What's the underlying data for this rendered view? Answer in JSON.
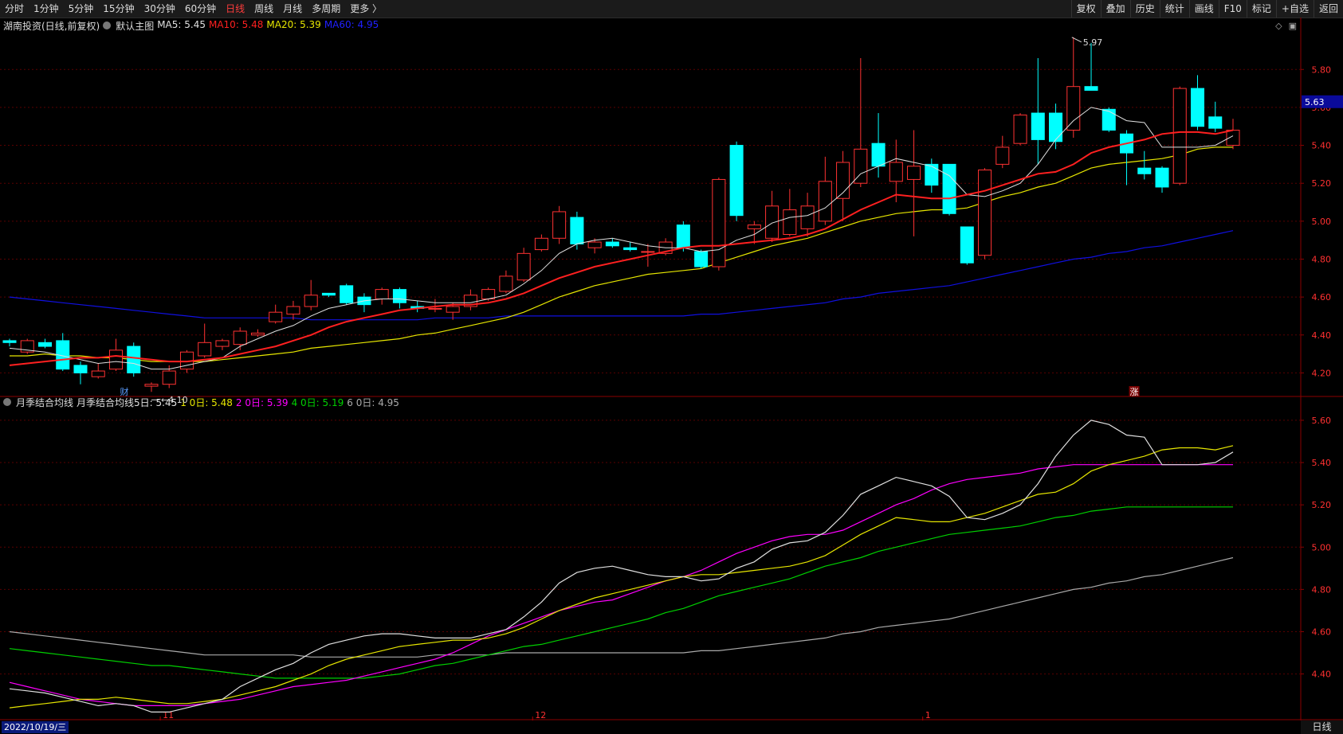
{
  "toolbar": {
    "periods": [
      "分时",
      "1分钟",
      "5分钟",
      "15分钟",
      "30分钟",
      "60分钟",
      "日线",
      "周线",
      "月线",
      "多周期",
      "更多 〉"
    ],
    "active_period": "日线",
    "right_items": [
      "复权",
      "叠加",
      "历史",
      "统计",
      "画线",
      "F10",
      "标记",
      "+自选",
      "返回"
    ]
  },
  "main_info": {
    "stock": "湖南投资(日线,前复权)",
    "template": "默认主图",
    "ma5": "MA5: 5.45",
    "ma10": "MA10: 5.48",
    "ma20": "MA20: 5.39",
    "ma60": "MA60: 4.95"
  },
  "sub_info": {
    "name": "月季结合均线",
    "prefix": "月季结合均线5日: 5.45",
    "d10": "1 0日: 5.48",
    "d20": "2 0日: 5.39",
    "d40": "4 0日: 5.19",
    "d60": "6 0日: 4.95"
  },
  "annotations": {
    "high": "5.97",
    "low": "4.10",
    "price_tag": "5.63",
    "event1": "财",
    "event2": "涨"
  },
  "bottom": {
    "date": "2022/10/19/三",
    "period": "日线",
    "month_labels": [
      "11",
      "12",
      "1"
    ]
  },
  "colors": {
    "up": "#ff3232",
    "down": "#00ffff",
    "ma5": "#e0e0e0",
    "ma10": "#ff2020",
    "ma20": "#e6e600",
    "ma60": "#1010e0",
    "sub40": "#00d000",
    "sub20": "#ff00ff",
    "axis": "#8b0000"
  },
  "chart_data": [
    {
      "type": "candlestick",
      "title": "湖南投资(日线,前复权)",
      "y_ticks": [
        "5.80",
        "5.60",
        "5.40",
        "5.20",
        "5.00",
        "4.80",
        "4.60",
        "4.40",
        "4.20"
      ],
      "ylim": [
        4.08,
        5.99
      ],
      "candles_ohlc": [
        [
          4.37,
          4.38,
          4.34,
          4.36
        ],
        [
          4.31,
          4.38,
          4.3,
          4.37
        ],
        [
          4.36,
          4.38,
          4.33,
          4.34
        ],
        [
          4.37,
          4.41,
          4.21,
          4.22
        ],
        [
          4.24,
          4.26,
          4.14,
          4.2
        ],
        [
          4.18,
          4.25,
          4.17,
          4.21
        ],
        [
          4.22,
          4.38,
          4.21,
          4.32
        ],
        [
          4.34,
          4.36,
          4.18,
          4.2
        ],
        [
          4.13,
          4.15,
          4.1,
          4.14
        ],
        [
          4.14,
          4.24,
          4.12,
          4.21
        ],
        [
          4.22,
          4.32,
          4.2,
          4.31
        ],
        [
          4.29,
          4.46,
          4.28,
          4.36
        ],
        [
          4.34,
          4.38,
          4.32,
          4.37
        ],
        [
          4.35,
          4.44,
          4.32,
          4.42
        ],
        [
          4.4,
          4.43,
          4.39,
          4.41
        ],
        [
          4.47,
          4.56,
          4.46,
          4.52
        ],
        [
          4.51,
          4.58,
          4.48,
          4.55
        ],
        [
          4.55,
          4.69,
          4.53,
          4.61
        ],
        [
          4.62,
          4.62,
          4.6,
          4.61
        ],
        [
          4.66,
          4.67,
          4.56,
          4.57
        ],
        [
          4.6,
          4.62,
          4.52,
          4.56
        ],
        [
          4.59,
          4.65,
          4.56,
          4.64
        ],
        [
          4.64,
          4.65,
          4.54,
          4.57
        ],
        [
          4.55,
          4.58,
          4.52,
          4.54
        ],
        [
          4.54,
          4.59,
          4.52,
          4.54
        ],
        [
          4.52,
          4.57,
          4.48,
          4.55
        ],
        [
          4.55,
          4.64,
          4.53,
          4.61
        ],
        [
          4.59,
          4.65,
          4.58,
          4.64
        ],
        [
          4.63,
          4.74,
          4.62,
          4.71
        ],
        [
          4.69,
          4.86,
          4.68,
          4.83
        ],
        [
          4.85,
          4.93,
          4.84,
          4.91
        ],
        [
          4.91,
          5.08,
          4.88,
          5.05
        ],
        [
          5.02,
          5.05,
          4.85,
          4.88
        ],
        [
          4.86,
          4.91,
          4.83,
          4.89
        ],
        [
          4.89,
          4.91,
          4.86,
          4.87
        ],
        [
          4.86,
          4.89,
          4.84,
          4.85
        ],
        [
          4.84,
          4.88,
          4.76,
          4.84
        ],
        [
          4.83,
          4.91,
          4.82,
          4.89
        ],
        [
          4.98,
          5.0,
          4.84,
          4.86
        ],
        [
          4.84,
          4.85,
          4.75,
          4.76
        ],
        [
          4.76,
          5.23,
          4.74,
          5.22
        ],
        [
          5.4,
          5.42,
          5.0,
          5.03
        ],
        [
          4.96,
          5.0,
          4.88,
          4.98
        ],
        [
          4.91,
          5.16,
          4.89,
          5.08
        ],
        [
          4.93,
          5.17,
          4.92,
          5.06
        ],
        [
          4.96,
          5.15,
          4.92,
          5.08
        ],
        [
          5.0,
          5.34,
          4.98,
          5.21
        ],
        [
          5.12,
          5.37,
          5.0,
          5.31
        ],
        [
          5.2,
          5.86,
          5.18,
          5.38
        ],
        [
          5.41,
          5.57,
          5.23,
          5.29
        ],
        [
          5.21,
          5.43,
          5.1,
          5.31
        ],
        [
          5.22,
          5.48,
          4.92,
          5.29
        ],
        [
          5.3,
          5.33,
          5.15,
          5.19
        ],
        [
          5.3,
          5.3,
          5.03,
          5.04
        ],
        [
          4.97,
          4.97,
          4.77,
          4.78
        ],
        [
          4.82,
          5.28,
          4.8,
          5.27
        ],
        [
          5.3,
          5.45,
          5.28,
          5.39
        ],
        [
          5.41,
          5.57,
          5.4,
          5.56
        ],
        [
          5.57,
          5.86,
          5.3,
          5.43
        ],
        [
          5.57,
          5.62,
          5.38,
          5.42
        ],
        [
          5.48,
          5.97,
          5.44,
          5.71
        ],
        [
          5.71,
          5.94,
          5.69,
          5.69
        ],
        [
          5.59,
          5.6,
          5.47,
          5.48
        ],
        [
          5.46,
          5.48,
          5.19,
          5.36
        ],
        [
          5.28,
          5.37,
          5.22,
          5.25
        ],
        [
          5.28,
          5.29,
          5.15,
          5.18
        ],
        [
          5.2,
          5.71,
          5.19,
          5.7
        ],
        [
          5.7,
          5.77,
          5.48,
          5.5
        ],
        [
          5.55,
          5.63,
          5.47,
          5.49
        ],
        [
          5.4,
          5.54,
          5.38,
          5.48
        ]
      ],
      "ma5": [
        4.33,
        4.32,
        4.31,
        4.29,
        4.27,
        4.25,
        4.26,
        4.25,
        4.22,
        4.22,
        4.24,
        4.26,
        4.28,
        4.34,
        4.38,
        4.42,
        4.45,
        4.5,
        4.54,
        4.56,
        4.58,
        4.59,
        4.59,
        4.58,
        4.57,
        4.57,
        4.57,
        4.59,
        4.61,
        4.67,
        4.74,
        4.83,
        4.88,
        4.9,
        4.91,
        4.89,
        4.87,
        4.86,
        4.86,
        4.84,
        4.85,
        4.9,
        4.93,
        4.99,
        5.02,
        5.03,
        5.07,
        5.15,
        5.25,
        5.29,
        5.33,
        5.31,
        5.29,
        5.24,
        5.14,
        5.13,
        5.16,
        5.2,
        5.3,
        5.43,
        5.53,
        5.6,
        5.58,
        5.53,
        5.52,
        5.39,
        5.39,
        5.39,
        5.4,
        5.45
      ],
      "ma10": [
        4.24,
        4.25,
        4.26,
        4.27,
        4.28,
        4.28,
        4.29,
        4.28,
        4.27,
        4.26,
        4.26,
        4.27,
        4.28,
        4.3,
        4.32,
        4.34,
        4.37,
        4.4,
        4.44,
        4.47,
        4.49,
        4.51,
        4.53,
        4.54,
        4.55,
        4.56,
        4.56,
        4.57,
        4.59,
        4.62,
        4.66,
        4.7,
        4.73,
        4.76,
        4.78,
        4.8,
        4.82,
        4.84,
        4.86,
        4.87,
        4.87,
        4.88,
        4.89,
        4.9,
        4.91,
        4.93,
        4.96,
        5.01,
        5.06,
        5.1,
        5.14,
        5.13,
        5.12,
        5.12,
        5.14,
        5.16,
        5.19,
        5.22,
        5.25,
        5.26,
        5.3,
        5.36,
        5.39,
        5.41,
        5.43,
        5.46,
        5.47,
        5.47,
        5.46,
        5.48
      ],
      "ma20": [
        4.29,
        4.29,
        4.3,
        4.29,
        4.29,
        4.28,
        4.28,
        4.27,
        4.26,
        4.26,
        4.26,
        4.26,
        4.27,
        4.28,
        4.29,
        4.3,
        4.31,
        4.33,
        4.34,
        4.35,
        4.36,
        4.37,
        4.38,
        4.4,
        4.41,
        4.43,
        4.45,
        4.47,
        4.49,
        4.52,
        4.56,
        4.6,
        4.63,
        4.66,
        4.68,
        4.7,
        4.72,
        4.73,
        4.74,
        4.75,
        4.78,
        4.81,
        4.84,
        4.87,
        4.89,
        4.91,
        4.94,
        4.97,
        5.0,
        5.02,
        5.04,
        5.05,
        5.06,
        5.06,
        5.07,
        5.1,
        5.13,
        5.15,
        5.18,
        5.2,
        5.24,
        5.28,
        5.3,
        5.31,
        5.32,
        5.33,
        5.35,
        5.38,
        5.39,
        5.39
      ],
      "ma60": [
        4.6,
        4.59,
        4.58,
        4.57,
        4.56,
        4.55,
        4.54,
        4.53,
        4.52,
        4.51,
        4.5,
        4.49,
        4.49,
        4.49,
        4.49,
        4.49,
        4.49,
        4.48,
        4.48,
        4.48,
        4.48,
        4.48,
        4.48,
        4.48,
        4.49,
        4.49,
        4.49,
        4.49,
        4.5,
        4.5,
        4.5,
        4.5,
        4.5,
        4.5,
        4.5,
        4.5,
        4.5,
        4.5,
        4.5,
        4.51,
        4.51,
        4.52,
        4.53,
        4.54,
        4.55,
        4.56,
        4.57,
        4.59,
        4.6,
        4.62,
        4.63,
        4.64,
        4.65,
        4.66,
        4.68,
        4.7,
        4.72,
        4.74,
        4.76,
        4.78,
        4.8,
        4.81,
        4.83,
        4.84,
        4.86,
        4.87,
        4.89,
        4.91,
        4.93,
        4.95
      ]
    },
    {
      "type": "line",
      "title": "月季结合均线",
      "y_ticks": [
        "5.60",
        "5.40",
        "5.20",
        "5.00",
        "4.80",
        "4.60",
        "4.40"
      ],
      "ylim": [
        4.18,
        5.66
      ],
      "series": [
        {
          "name": "月季结合均线5日",
          "color": "#e0e0e0",
          "values": "ma5"
        },
        {
          "name": "1 0日",
          "color": "#e6e600",
          "values": "ma10"
        },
        {
          "name": "2 0日",
          "color": "#ff00ff",
          "values": "ma20_sub"
        },
        {
          "name": "4 0日",
          "color": "#00d000",
          "values": "ma40"
        },
        {
          "name": "6 0日",
          "color": "#aaaaaa",
          "values": "ma60"
        }
      ],
      "ma20_sub": [
        4.36,
        4.34,
        4.32,
        4.3,
        4.28,
        4.27,
        4.26,
        4.25,
        4.25,
        4.25,
        4.25,
        4.26,
        4.27,
        4.28,
        4.3,
        4.32,
        4.34,
        4.35,
        4.36,
        4.37,
        4.39,
        4.41,
        4.43,
        4.45,
        4.47,
        4.5,
        4.54,
        4.58,
        4.61,
        4.64,
        4.67,
        4.7,
        4.72,
        4.74,
        4.75,
        4.78,
        4.81,
        4.84,
        4.86,
        4.89,
        4.93,
        4.97,
        5.0,
        5.03,
        5.05,
        5.06,
        5.06,
        5.08,
        5.12,
        5.16,
        5.2,
        5.23,
        5.27,
        5.3,
        5.32,
        5.33,
        5.34,
        5.35,
        5.37,
        5.38,
        5.39,
        5.39,
        5.39,
        5.39,
        5.39,
        5.39,
        5.39,
        5.39,
        5.39,
        5.39
      ],
      "ma40": [
        4.52,
        4.51,
        4.5,
        4.49,
        4.48,
        4.47,
        4.46,
        4.45,
        4.44,
        4.44,
        4.43,
        4.42,
        4.41,
        4.4,
        4.39,
        4.38,
        4.38,
        4.38,
        4.38,
        4.38,
        4.38,
        4.39,
        4.4,
        4.42,
        4.44,
        4.45,
        4.47,
        4.49,
        4.51,
        4.53,
        4.54,
        4.56,
        4.58,
        4.6,
        4.62,
        4.64,
        4.66,
        4.69,
        4.71,
        4.74,
        4.77,
        4.79,
        4.81,
        4.83,
        4.85,
        4.88,
        4.91,
        4.93,
        4.95,
        4.98,
        5.0,
        5.02,
        5.04,
        5.06,
        5.07,
        5.08,
        5.09,
        5.1,
        5.12,
        5.14,
        5.15,
        5.17,
        5.18,
        5.19,
        5.19,
        5.19,
        5.19,
        5.19,
        5.19,
        5.19
      ]
    }
  ]
}
